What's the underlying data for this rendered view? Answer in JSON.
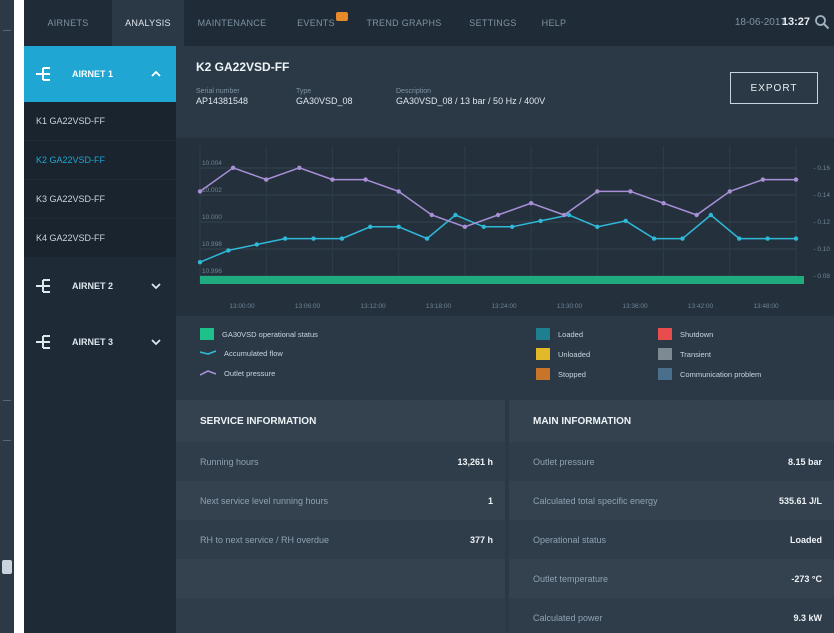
{
  "nav": {
    "tabs": [
      {
        "label": "AIRNETS"
      },
      {
        "label": "ANALYSIS"
      },
      {
        "label": "MAINTENANCE"
      },
      {
        "label": "EVENTS"
      },
      {
        "label": "TREND GRAPHS"
      },
      {
        "label": "SETTINGS"
      },
      {
        "label": "HELP"
      }
    ],
    "date": "18-06-2017",
    "time": "13:27"
  },
  "sidebar": {
    "airnet1": {
      "label": "AIRNET 1"
    },
    "items": [
      {
        "label": "K1 GA22VSD-FF"
      },
      {
        "label": "K2 GA22VSD-FF"
      },
      {
        "label": "K3 GA22VSD-FF"
      },
      {
        "label": "K4 GA22VSD-FF"
      }
    ],
    "airnet2": {
      "label": "AIRNET 2"
    },
    "airnet3": {
      "label": "AIRNET 3"
    }
  },
  "header": {
    "title": "K2 GA22VSD-FF",
    "serial_label": "Serial number",
    "serial_value": "AP14381548",
    "type_label": "Type",
    "type_value": "GA30VSD_08",
    "desc_label": "Description",
    "desc_value": "GA30VSD_08 / 13 bar / 50 Hz / 400V",
    "export_label": "EXPORT"
  },
  "chart_data": {
    "type": "line",
    "x": [
      "13:00:00",
      "13:06:00",
      "13:12:00",
      "13:18:00",
      "13:24:00",
      "13:30:00",
      "13:36:00",
      "13:42:00",
      "13:48:00"
    ],
    "series": [
      {
        "name": "Accumulated flow",
        "color": "#2fb8d8",
        "values": [
          0.08,
          0.09,
          0.095,
          0.1,
          0.1,
          0.1,
          0.11,
          0.11,
          0.1,
          0.12,
          0.11,
          0.11,
          0.115,
          0.12,
          0.11,
          0.115,
          0.1,
          0.1,
          0.12,
          0.1,
          0.1,
          0.1
        ]
      },
      {
        "name": "Outlet pressure",
        "color": "#a98fd6",
        "values": [
          0.14,
          0.16,
          0.15,
          0.16,
          0.15,
          0.15,
          0.14,
          0.12,
          0.11,
          0.12,
          0.13,
          0.12,
          0.14,
          0.14,
          0.13,
          0.12,
          0.14,
          0.15,
          0.15
        ]
      },
      {
        "name": "GA30VSD operational status",
        "color": "#1ec18a",
        "values": []
      }
    ],
    "left_ticks": [
      "10.004",
      "10.002",
      "10.000",
      "10.998",
      "10.996"
    ],
    "right_ticks": [
      "0.16",
      "0.14",
      "0.12",
      "0.10",
      "0.08"
    ]
  },
  "legend": {
    "status_label": "GA30VSD operational status",
    "flow_label": "Accumulated flow",
    "pressure_label": "Outlet pressure",
    "loaded": "Loaded",
    "unloaded": "Unloaded",
    "stopped": "Stopped",
    "shutdown": "Shutdown",
    "transient": "Transient",
    "comm_problem": "Communication problem",
    "colors": {
      "loaded": "#1d7f8f",
      "unloaded": "#e2b928",
      "stopped": "#c8752a",
      "shutdown": "#e94c4c",
      "transient": "#7d8a94",
      "comm": "#4a6f8c",
      "status": "#1ec18a",
      "flow": "#2fb8d8",
      "pressure": "#a98fd6"
    }
  },
  "service": {
    "header": "SERVICE INFORMATION",
    "rows": [
      {
        "label": "Running hours",
        "value": "13,261 h"
      },
      {
        "label": "Next service level running hours",
        "value": "1"
      },
      {
        "label": "RH to next service / RH overdue",
        "value": "377 h"
      }
    ]
  },
  "main": {
    "header": "MAIN INFORMATION",
    "rows": [
      {
        "label": "Outlet pressure",
        "value": "8.15 bar"
      },
      {
        "label": "Calculated total specific energy",
        "value": "535.61 J/L"
      },
      {
        "label": "Operational status",
        "value": "Loaded"
      },
      {
        "label": "Outlet temperature",
        "value": "-273 °C"
      },
      {
        "label": "Calculated power",
        "value": "9.3 kW"
      }
    ]
  }
}
